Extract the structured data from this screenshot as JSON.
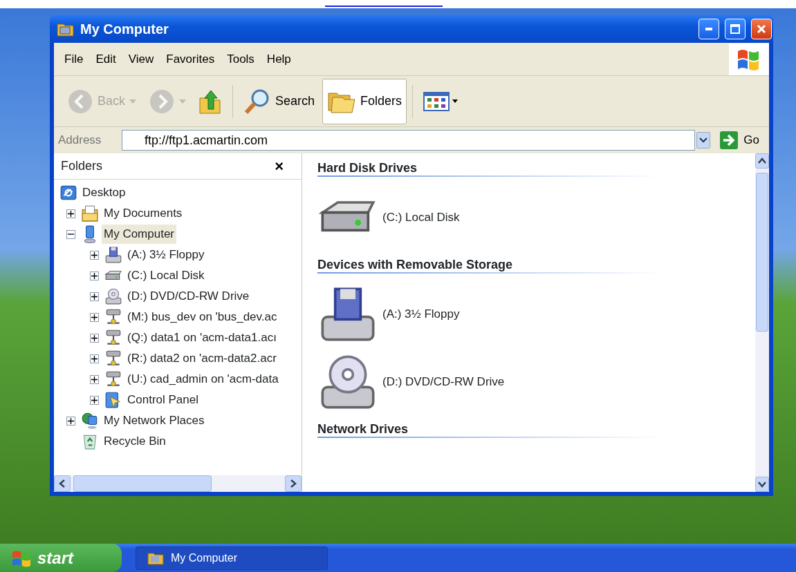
{
  "window": {
    "title": "My Computer"
  },
  "menu": [
    "File",
    "Edit",
    "View",
    "Favorites",
    "Tools",
    "Help"
  ],
  "toolbar": [
    {
      "kind": "back",
      "label": "Back",
      "disabled": true,
      "selected": false
    },
    {
      "kind": "forward",
      "disabled": true,
      "selected": false
    },
    {
      "kind": "up",
      "disabled": false,
      "selected": false
    },
    {
      "kind": "search",
      "label": "Search",
      "disabled": false,
      "selected": false
    },
    {
      "kind": "folders",
      "label": "Folders",
      "disabled": false,
      "selected": true
    },
    {
      "kind": "views",
      "disabled": false,
      "selected": false
    }
  ],
  "address": {
    "label": "Address",
    "value": "ftp://ftp1.acmartin.com",
    "go": "Go"
  },
  "folders_pane": {
    "title": "Folders",
    "close": "×",
    "tree": [
      {
        "label": "Desktop",
        "kind": "desktop",
        "selected": false,
        "children": [
          {
            "label": "My Documents",
            "kind": "documents",
            "expanded": false,
            "selected": false
          },
          {
            "label": "My Computer",
            "kind": "computer",
            "expanded": true,
            "selected": true,
            "children": [
              {
                "label": "(A:) 3½ Floppy",
                "kind": "floppy",
                "expanded": false,
                "selected": false
              },
              {
                "label": "(C:) Local Disk",
                "kind": "disk",
                "expanded": false,
                "selected": false
              },
              {
                "label": "(D:) DVD/CD-RW Drive",
                "kind": "dvd",
                "expanded": false,
                "selected": false
              },
              {
                "label": "(M:) bus_dev on 'bus_dev.ac",
                "kind": "netdrive",
                "expanded": false,
                "selected": false
              },
              {
                "label": "(Q:) data1 on 'acm-data1.acı",
                "kind": "netdrive",
                "expanded": false,
                "selected": false
              },
              {
                "label": "(R:) data2 on 'acm-data2.acr",
                "kind": "netdrive",
                "expanded": false,
                "selected": false
              },
              {
                "label": "(U:) cad_admin on 'acm-data",
                "kind": "netdrive",
                "expanded": false,
                "selected": false
              },
              {
                "label": "Control Panel",
                "kind": "control",
                "expanded": false,
                "selected": false
              }
            ]
          },
          {
            "label": "My Network Places",
            "kind": "network",
            "expanded": false,
            "selected": false
          },
          {
            "label": "Recycle Bin",
            "kind": "recycle",
            "selected": false
          }
        ]
      }
    ]
  },
  "groups": [
    {
      "heading": "Hard Disk Drives",
      "items": [
        {
          "label": "(C:) Local Disk",
          "kind": "disk"
        }
      ]
    },
    {
      "heading": "Devices with Removable Storage",
      "items": [
        {
          "label": "(A:) 3½ Floppy",
          "kind": "floppy"
        },
        {
          "label": "(D:) DVD/CD-RW Drive",
          "kind": "dvd"
        }
      ]
    },
    {
      "heading": "Network Drives"
    }
  ],
  "taskbar": {
    "start": "start",
    "tasks": [
      {
        "label": "My Computer",
        "selected": false
      }
    ]
  }
}
